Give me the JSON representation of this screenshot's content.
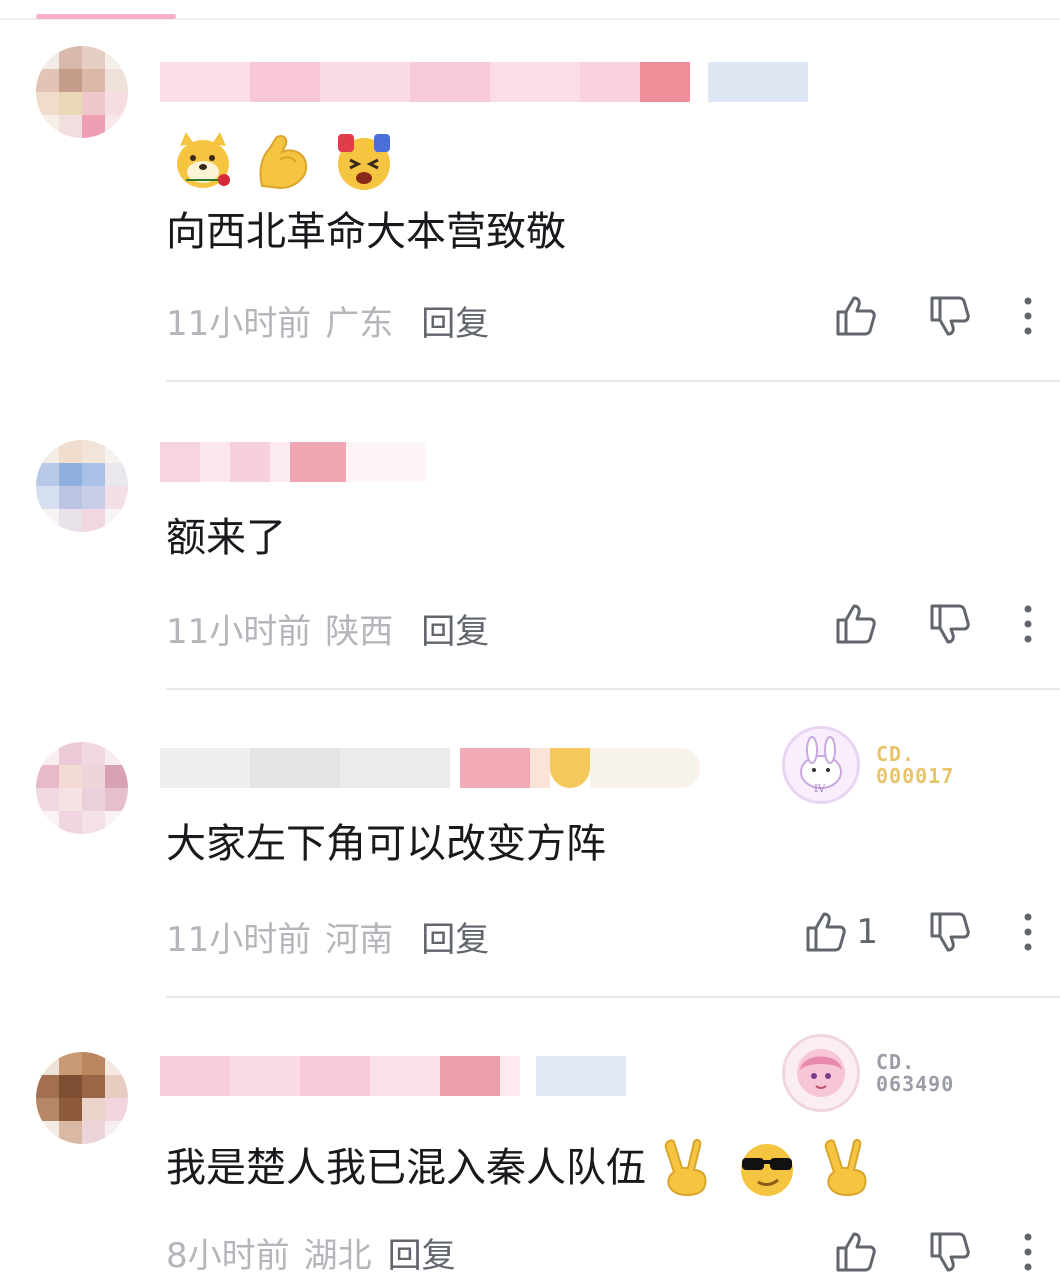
{
  "comments": [
    {
      "text": "向西北革命大本营致敬",
      "emojis": [
        "doge-rose-emoji",
        "strong-arm-emoji",
        "excited-face-emoji"
      ],
      "time": "11小时前",
      "location": "广东",
      "reply": "回复",
      "likes": ""
    },
    {
      "text": "额来了",
      "time": "11小时前",
      "location": "陕西",
      "reply": "回复",
      "likes": ""
    },
    {
      "text": "大家左下角可以改变方阵",
      "time": "11小时前",
      "location": "河南",
      "reply": "回复",
      "likes": "1",
      "badge_code": "CD.\n000017",
      "badge_color": "#e8c46a"
    },
    {
      "text": "我是楚人我已混入秦人队伍",
      "trailing_emojis": [
        "victory-hand-emoji",
        "sunglasses-face-emoji",
        "victory-hand-emoji"
      ],
      "time": "8小时前",
      "location": "湖北",
      "reply": "回复",
      "likes": "",
      "badge_code": "CD.\n063490",
      "badge_color": "#9a9ca6"
    }
  ],
  "colors": {
    "accent": "#fb7299",
    "meta": "#b4b6bb",
    "reply": "#61666d",
    "text": "#18191c"
  }
}
